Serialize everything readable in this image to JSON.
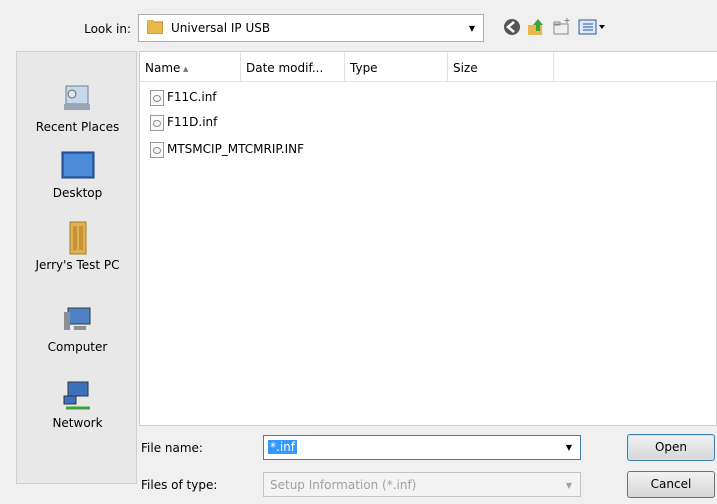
{
  "top": {
    "lookin_label": "Look in:",
    "lookin_value": "Universal IP USB"
  },
  "places": [
    {
      "label": "Recent Places",
      "icon": "recent-places-icon"
    },
    {
      "label": "Desktop",
      "icon": "desktop-icon"
    },
    {
      "label": "Jerry's Test PC",
      "icon": "user-folder-icon"
    },
    {
      "label": "Computer",
      "icon": "computer-icon"
    },
    {
      "label": "Network",
      "icon": "network-icon"
    }
  ],
  "columns": [
    "Name",
    "Date modif...",
    "Type",
    "Size"
  ],
  "files": [
    "F11C.inf",
    "F11D.inf",
    "MTSMCIP_MTCMRIP.INF"
  ],
  "bottom": {
    "filename_label": "File name:",
    "filename_value": "*.inf",
    "filetype_label": "Files of type:",
    "filetype_value": "Setup Information (*.inf)",
    "open": "Open",
    "cancel": "Cancel"
  }
}
